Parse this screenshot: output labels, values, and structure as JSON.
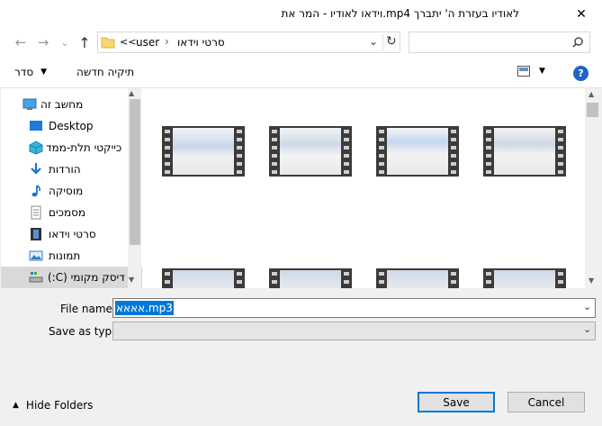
{
  "window": {
    "title": "לאודיו בעזרת ה' יתברך mp4.וידאו לאודיו - המר את",
    "close_glyph": "✕"
  },
  "nav": {
    "back_glyph": "←",
    "forward_glyph": "→",
    "recent_glyph": "⌄",
    "up_glyph": "↑",
    "breadcrumb": [
      "user",
      "סרטי וידאו"
    ],
    "overflow_glyph": "<<",
    "refresh_glyph": "↻",
    "search_placeholder": ""
  },
  "toolbar": {
    "organize_label": "סדר",
    "new_folder_label": "תיקיה חדשה",
    "help_glyph": "?"
  },
  "sidebar": {
    "items": [
      {
        "label": "מחשב זה",
        "icon": "computer-icon"
      },
      {
        "label": "Desktop",
        "icon": "desktop-icon"
      },
      {
        "label": "כייקטי תלת-ממד",
        "icon": "3d-objects-icon"
      },
      {
        "label": "הורדות",
        "icon": "download-icon"
      },
      {
        "label": "מוסיקה",
        "icon": "music-icon"
      },
      {
        "label": "מסמכים",
        "icon": "documents-icon"
      },
      {
        "label": "סרטי וידאו",
        "icon": "videos-icon"
      },
      {
        "label": "תמונות",
        "icon": "pictures-icon"
      },
      {
        "label": "דיסק מקומי (C:)",
        "icon": "drive-icon"
      }
    ]
  },
  "files": {
    "captions": [
      "",
      "",
      "",
      ""
    ]
  },
  "form": {
    "file_name_label": "File name:",
    "file_name_value": "אאאא.mp3",
    "save_as_type_label": "Save as type:",
    "save_as_type_value": ""
  },
  "footer": {
    "hide_folders_label": "Hide Folders",
    "save_label": "Save",
    "cancel_label": "Cancel"
  },
  "colors": {
    "accent": "#0078d7",
    "help_blue": "#1e64c8",
    "selection_bg": "#cce8ff"
  }
}
